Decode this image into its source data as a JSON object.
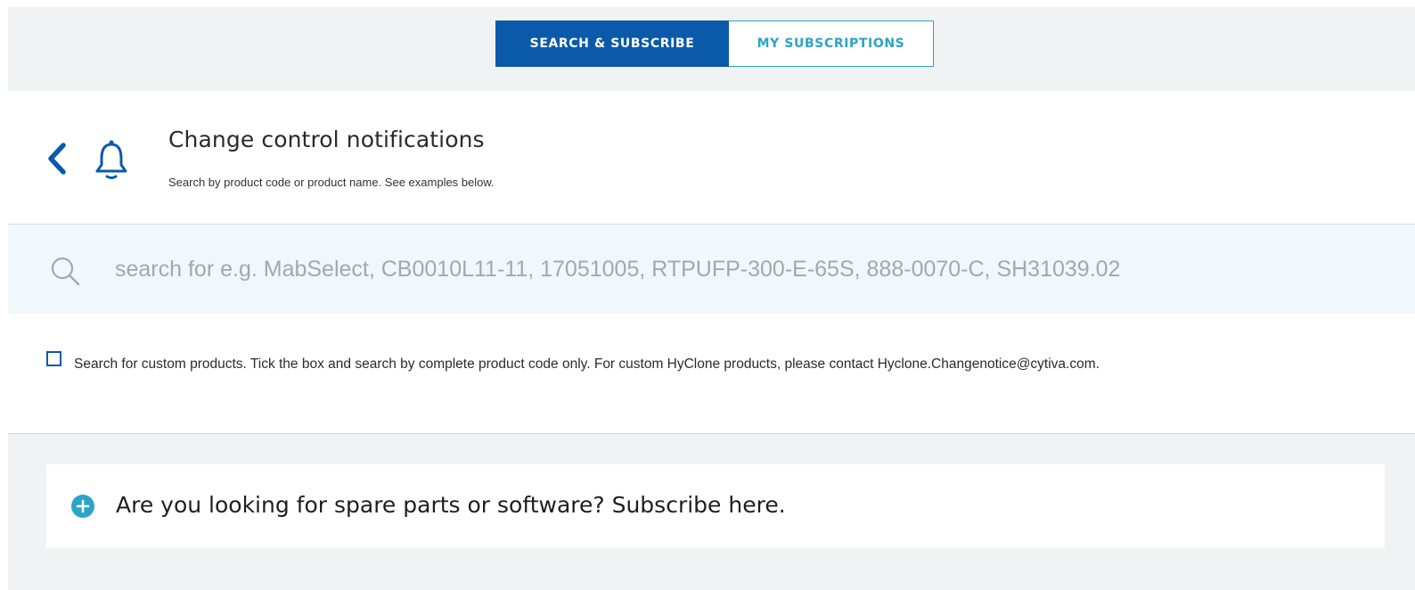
{
  "tabs": {
    "search_subscribe": "SEARCH & SUBSCRIBE",
    "my_subscriptions": "MY SUBSCRIPTIONS",
    "active": "search_subscribe"
  },
  "header": {
    "back_icon": "chevron-left-icon",
    "bell_icon": "bell-icon",
    "title": "Change control notifications",
    "subtitle": "Search by product code or product name. See examples below."
  },
  "search": {
    "icon": "search-icon",
    "value": "",
    "placeholder": "search for e.g. MabSelect, CB0010L11-11, 17051005, RTPUFP-300-E-65S, 888-0070-C, SH31039.02"
  },
  "custom_products": {
    "checked": false,
    "text": "Search for custom products. Tick the box and search by complete product code only. For custom HyClone products, please contact Hyclone.Changenotice@cytiva.com."
  },
  "spare_parts": {
    "icon": "plus-circle-icon",
    "text": "Are you looking for spare parts or software? Subscribe here."
  },
  "colors": {
    "primary_blue": "#0b5aaa",
    "accent_teal": "#2aa4c8",
    "panel_gray": "#f1f2f4",
    "search_bg": "#f1f8fb",
    "placeholder_gray": "#a3a8ad"
  }
}
